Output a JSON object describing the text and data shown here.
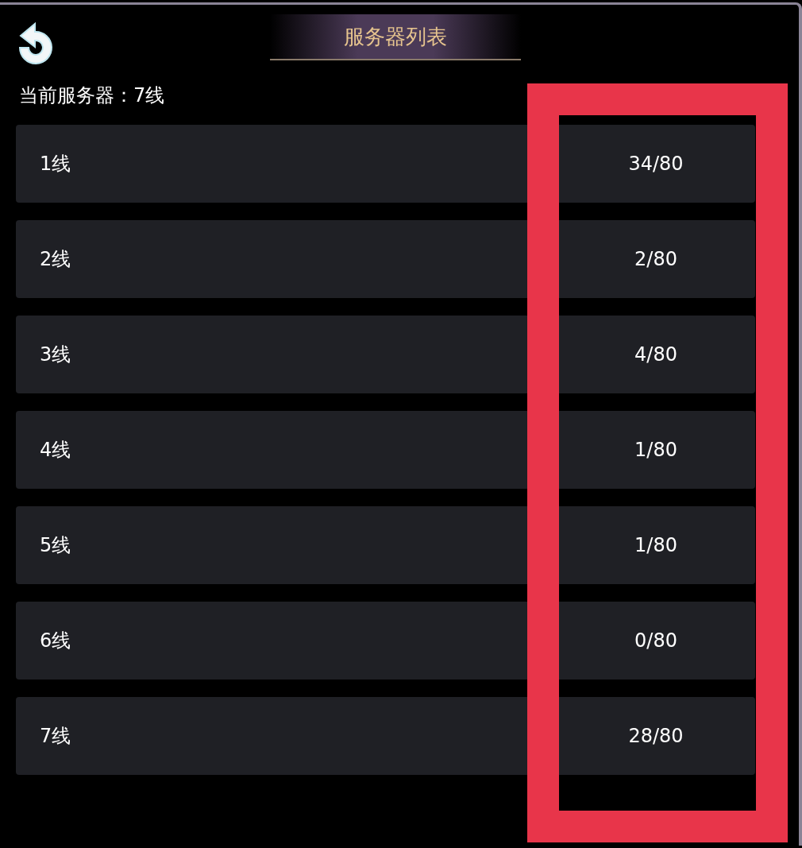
{
  "header": {
    "title": "服务器列表"
  },
  "current_server": "当前服务器：7线",
  "servers": [
    {
      "name": "1线",
      "count": "34/80"
    },
    {
      "name": "2线",
      "count": "2/80"
    },
    {
      "name": "3线",
      "count": "4/80"
    },
    {
      "name": "4线",
      "count": "1/80"
    },
    {
      "name": "5线",
      "count": "1/80"
    },
    {
      "name": "6线",
      "count": "0/80"
    },
    {
      "name": "7线",
      "count": "28/80"
    }
  ],
  "highlight": {
    "color": "#e8354a"
  }
}
